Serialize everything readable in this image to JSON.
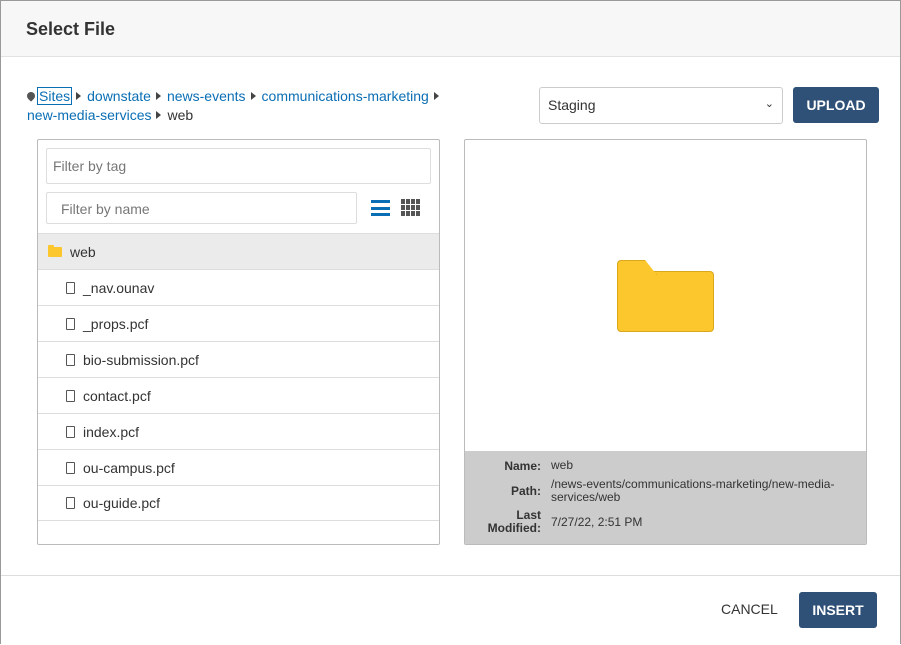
{
  "dialog": {
    "title": "Select File"
  },
  "breadcrumb": {
    "items": [
      "Sites",
      "downstate",
      "news-events",
      "communications-marketing",
      "new-media-services"
    ],
    "current": "web"
  },
  "environment": {
    "selected": "Staging"
  },
  "toolbar": {
    "upload_label": "UPLOAD"
  },
  "filters": {
    "tag_placeholder": "Filter by tag",
    "name_placeholder": "Filter by name"
  },
  "list": {
    "folder": "web",
    "files": [
      "_nav.ounav",
      "_props.pcf",
      "bio-submission.pcf",
      "contact.pcf",
      "index.pcf",
      "ou-campus.pcf",
      "ou-guide.pcf"
    ]
  },
  "details": {
    "name_label": "Name:",
    "name": "web",
    "path_label": "Path:",
    "path": "/news-events/communications-marketing/new-media-services/web",
    "modified_label": "Last Modified:",
    "modified": "7/27/22, 2:51 PM"
  },
  "footer": {
    "cancel_label": "CANCEL",
    "insert_label": "INSERT"
  },
  "colors": {
    "primary": "#2f5077",
    "link": "#0a6eb4",
    "folder": "#fcc62d"
  }
}
